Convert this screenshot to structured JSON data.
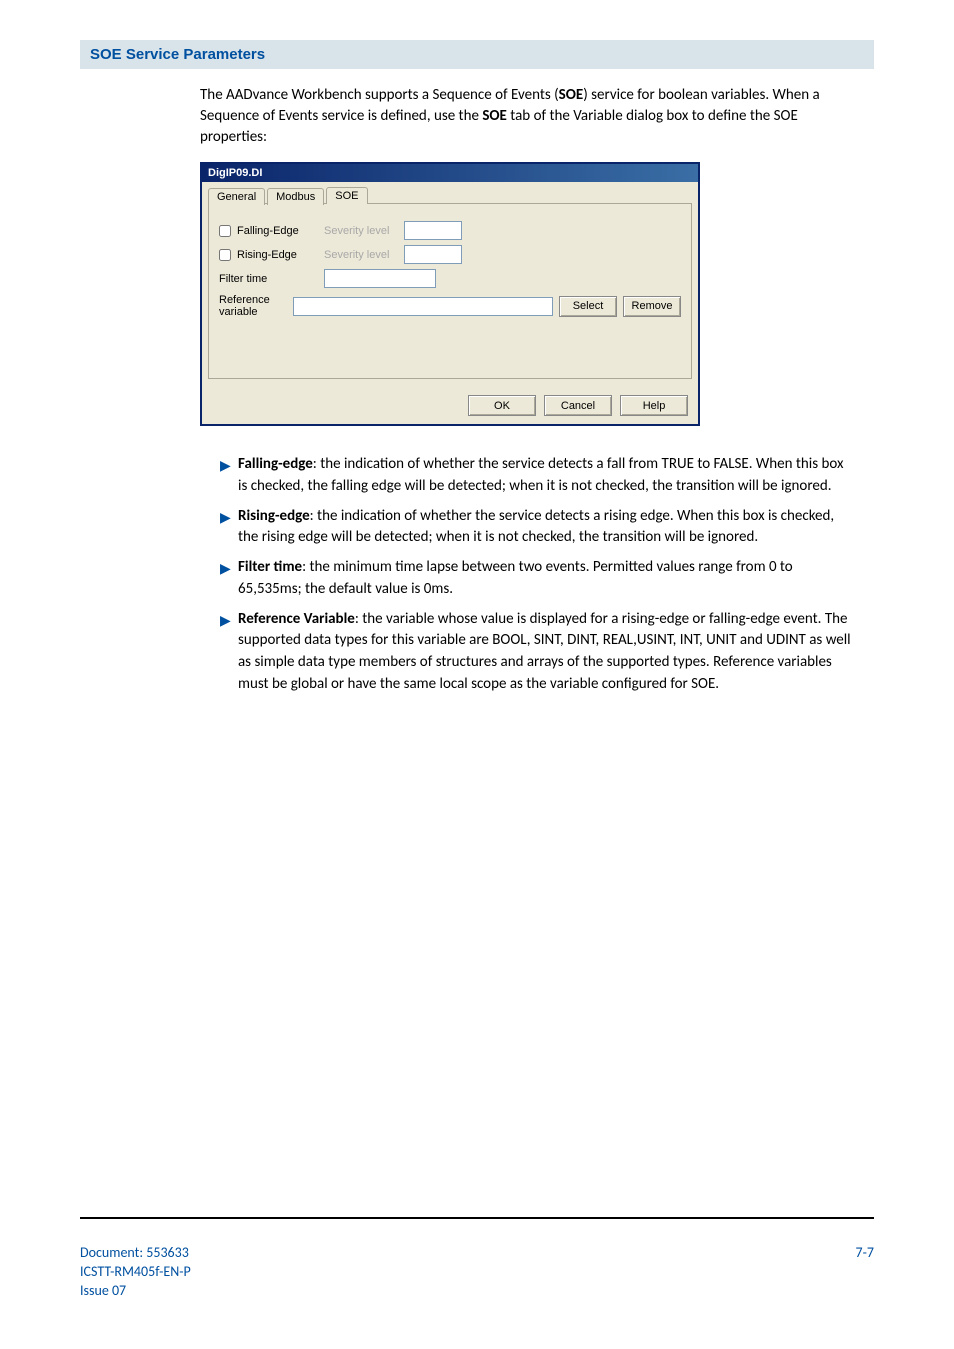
{
  "heading": "SOE Service Parameters",
  "intro": {
    "pre": "The  AADvance Workbench supports a Sequence of Events (",
    "soe1": "SOE",
    "mid": ") service for boolean variables. When a Sequence of Events service is defined, use the ",
    "soe2": "SOE",
    "post": " tab of the Variable dialog box to define the SOE properties:"
  },
  "dialog": {
    "title": "DigIP09.DI",
    "tabs": {
      "general": "General",
      "modbus": "Modbus",
      "soe": "SOE"
    },
    "labels": {
      "fallingEdge": "Falling-Edge",
      "risingEdge": "Rising-Edge",
      "severity1": "Severity level",
      "severity2": "Severity level",
      "filterTime": "Filter time",
      "reference": "Reference variable"
    },
    "buttons": {
      "select": "Select",
      "remove": "Remove",
      "ok": "OK",
      "cancel": "Cancel",
      "help": "Help"
    }
  },
  "bullets": [
    {
      "term": "Falling-edge",
      "text": ": the indication of whether the service detects a fall from TRUE to FALSE. When this box is checked, the falling edge will be detected; when it is not checked, the transition will be ignored."
    },
    {
      "term": "Rising-edge",
      "text": ": the indication of whether the service detects a rising edge. When this box is checked, the rising edge will be detected; when it is not checked, the transition will be ignored."
    },
    {
      "term": "Filter time",
      "text": ": the minimum time lapse between two events. Permitted values range from 0 to 65,535ms; the default value is 0ms."
    },
    {
      "term": "Reference Variable",
      "text": ": the variable whose value is displayed for a rising-edge or falling-edge event. The supported data types for this variable are BOOL, SINT, DINT, REAL,USINT, INT, UNIT and UDINT as well as simple data type members of structures and arrays of the supported types. Reference variables must be global or have the same local scope as the variable configured for SOE."
    }
  ],
  "footer": {
    "doc1": "Document: 553633",
    "doc2": "ICSTT-RM405f-EN-P",
    "doc3": " Issue 07",
    "page": "7-7"
  },
  "glyphs": {
    "arrow": "▶"
  }
}
